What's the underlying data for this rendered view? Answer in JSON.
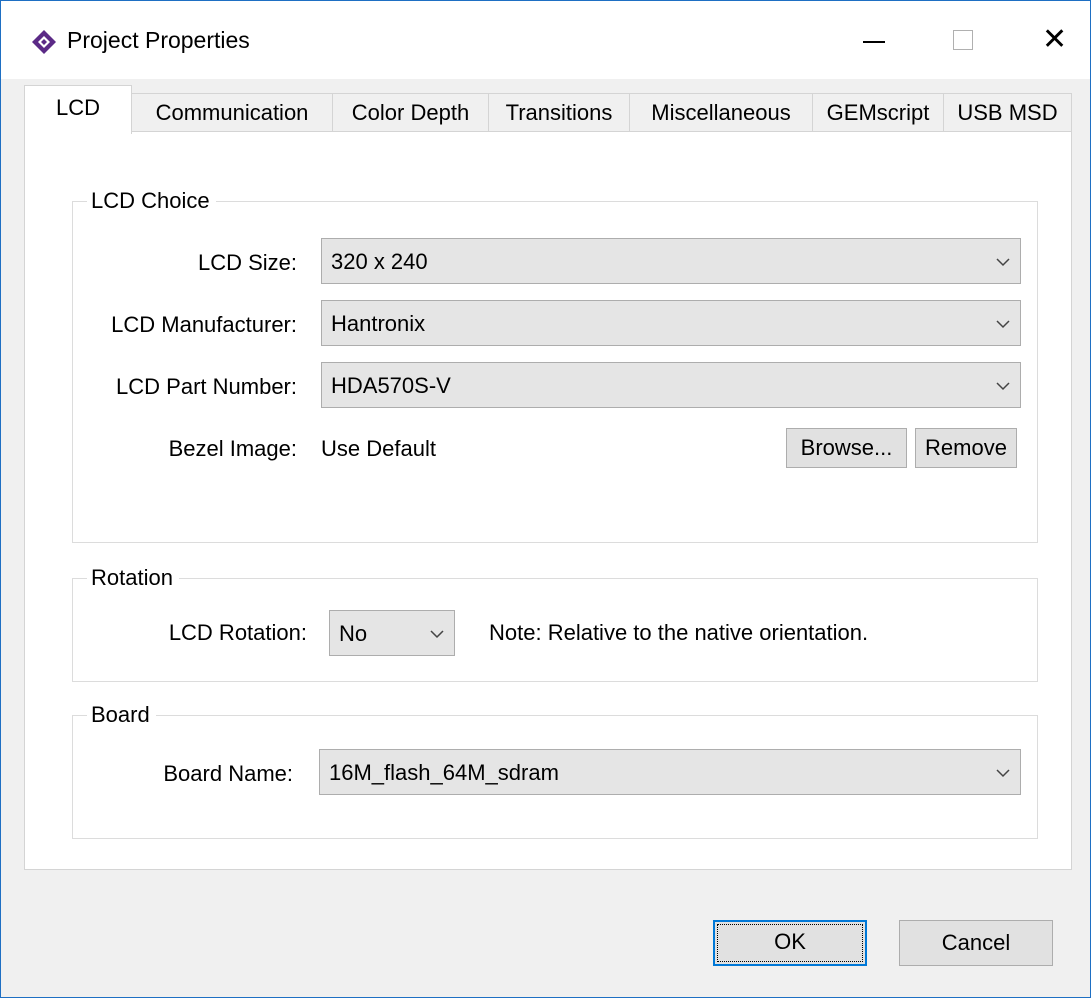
{
  "window": {
    "title": "Project Properties"
  },
  "colors": {
    "accent": "#0078d7",
    "border": "#1e6fc3",
    "icon": "#5b2a86"
  },
  "tabs": [
    {
      "label": "LCD",
      "active": true
    },
    {
      "label": "Communication"
    },
    {
      "label": "Color Depth"
    },
    {
      "label": "Transitions"
    },
    {
      "label": "Miscellaneous"
    },
    {
      "label": "GEMscript"
    },
    {
      "label": "USB MSD"
    }
  ],
  "lcd_choice": {
    "title": "LCD Choice",
    "size_label": "LCD Size:",
    "size_value": "320 x 240",
    "manufacturer_label": "LCD Manufacturer:",
    "manufacturer_value": "Hantronix",
    "part_label": "LCD Part Number:",
    "part_value": "HDA570S-V",
    "bezel_label": "Bezel Image:",
    "bezel_value": "Use Default",
    "browse_label": "Browse...",
    "remove_label": "Remove"
  },
  "rotation": {
    "title": "Rotation",
    "label": "LCD Rotation:",
    "value": "No",
    "note": "Note: Relative to the native orientation."
  },
  "board": {
    "title": "Board",
    "label": "Board Name:",
    "value": "16M_flash_64M_sdram"
  },
  "footer": {
    "ok_label": "OK",
    "cancel_label": "Cancel"
  }
}
